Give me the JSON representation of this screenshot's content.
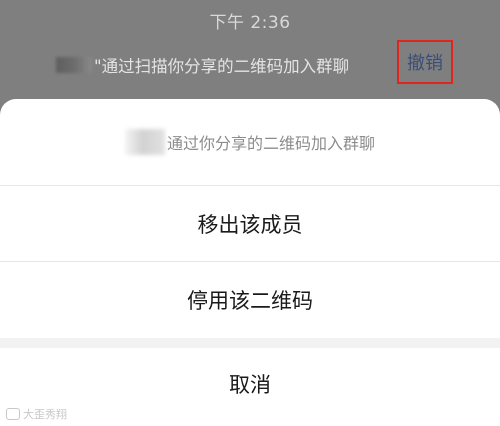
{
  "chat": {
    "timestamp": "下午 2:36",
    "system_message": "\"通过扫描你分享的二维码加入群聊",
    "revoke_label": "撤销"
  },
  "sheet": {
    "title": "通过你分享的二维码加入群聊",
    "options": [
      {
        "label": "移出该成员"
      },
      {
        "label": "停用该二维码"
      }
    ],
    "cancel_label": "取消"
  },
  "watermark": {
    "text": "大歪秀翔"
  },
  "colors": {
    "overlay": "#7f7f7f",
    "revoke_highlight": "#e0251f",
    "link": "#3a4f78",
    "sheet_bg": "#ffffff",
    "divider": "#e6e6e6"
  }
}
